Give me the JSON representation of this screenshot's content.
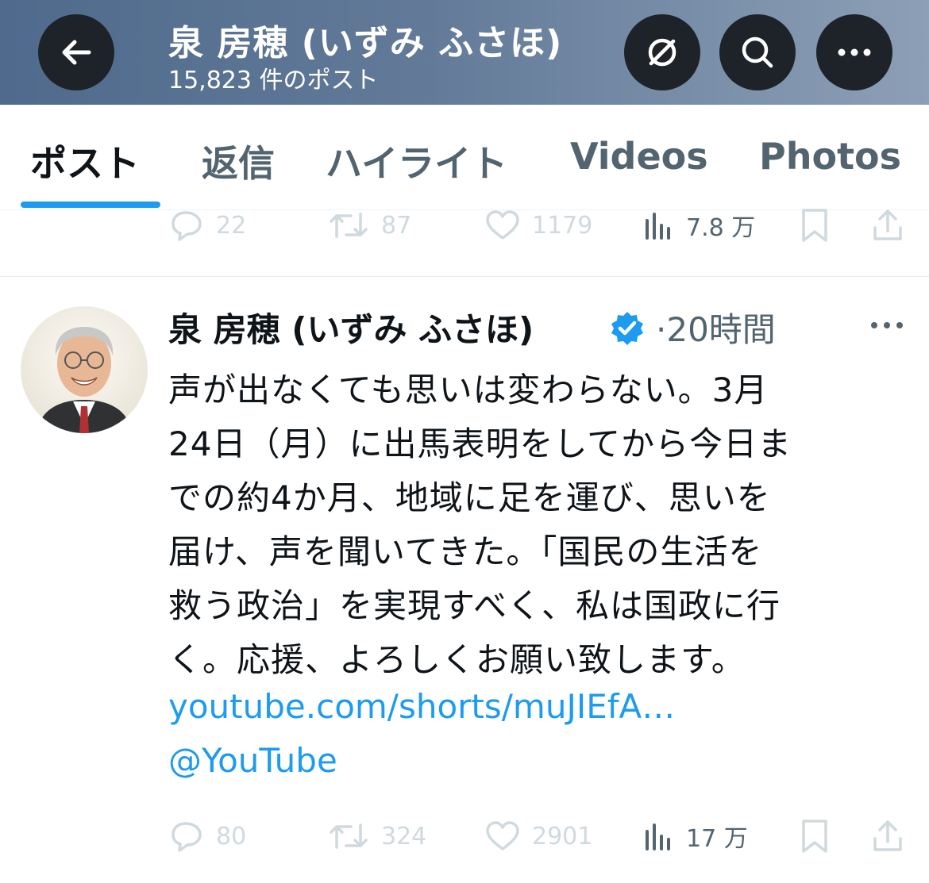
{
  "header": {
    "title": "泉 房穂 (いずみ ふさほ)",
    "subtitle": "15,823 件のポスト",
    "bg_color": "#5b7394",
    "button_color": "#1e2329",
    "icons": [
      "back-arrow-icon",
      "no-subscribe-icon",
      "search-icon",
      "more-icon"
    ]
  },
  "tabs": [
    {
      "label": "ポスト",
      "active": true
    },
    {
      "label": "返信",
      "active": false
    },
    {
      "label": "ハイライト",
      "active": false
    },
    {
      "label": "Videos",
      "active": false
    },
    {
      "label": "Photos",
      "active": false
    }
  ],
  "accent_color": "#1d9bf0",
  "prev_tweet": {
    "actions": {
      "replies": "22",
      "retweets": "87",
      "likes": "1179",
      "views": "7.8 万"
    }
  },
  "tweet": {
    "name": "泉 房穂 (いずみ ふさほ)",
    "time": "·20時間",
    "lines": [
      "声が出なくても思いは変わらない。3月",
      "24日（月）に出馬表明をしてから今日ま",
      "での約4か月、地域に足を運び、思いを",
      "届け、声を聞いてきた。「国民の生活を",
      "救う政治」を実現すべく、私は国政に行",
      "く。応援、よろしくお願い致します。"
    ],
    "link": "youtube.com/shorts/muJIEfA…",
    "mention": "@YouTube",
    "actions": {
      "replies": "80",
      "retweets": "324",
      "likes": "2901",
      "views": "17 万"
    }
  }
}
